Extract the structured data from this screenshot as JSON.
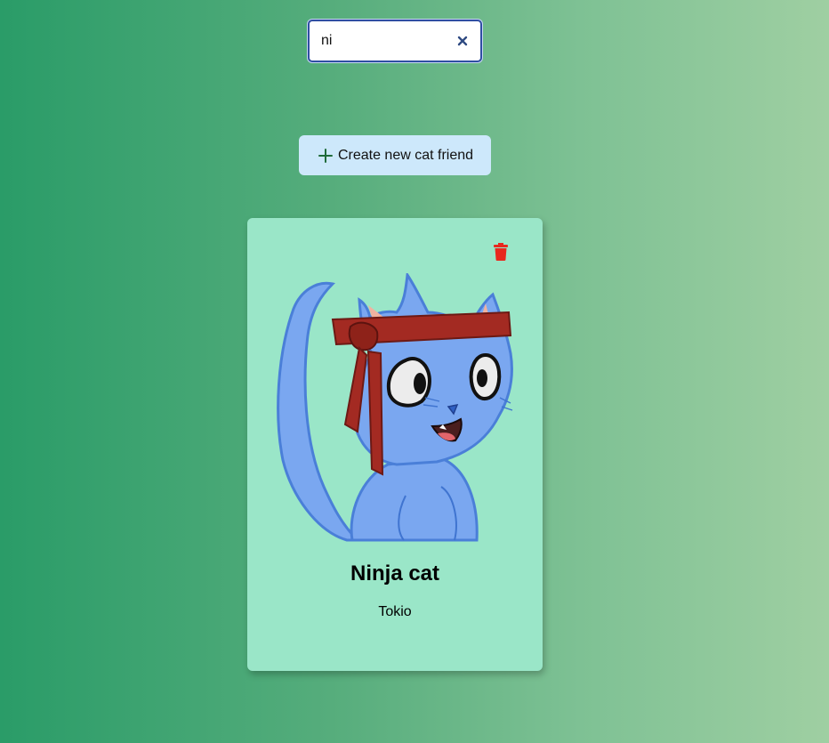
{
  "search": {
    "value": "ni",
    "clear_icon": "close-icon"
  },
  "toolbar": {
    "create_label": "Create new cat friend",
    "create_icon": "plus-icon",
    "create_icon_color": "#1f6b3a",
    "button_color": "#cde8fb"
  },
  "card": {
    "title": "Ninja cat",
    "location": "Tokio",
    "image": "ninja-cat-illustration",
    "delete_icon": "trash-icon",
    "delete_color": "#e8281e",
    "background": "#9ae6c8"
  }
}
